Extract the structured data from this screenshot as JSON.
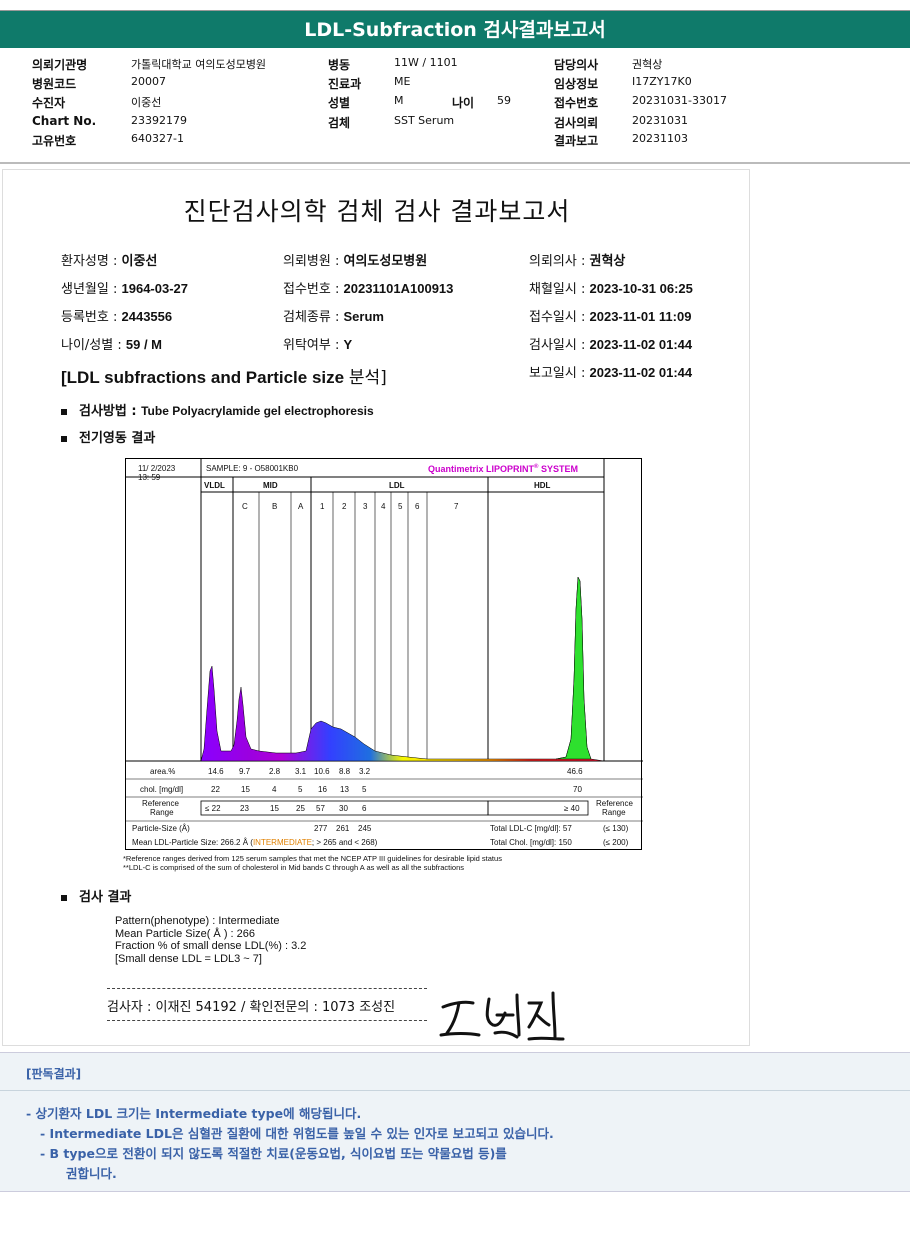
{
  "header": {
    "title": "LDL-Subfraction 검사결과보고서",
    "rows": [
      [
        {
          "l": "의뢰기관명",
          "v": "가톨릭대학교 여의도성모병원"
        },
        {
          "l": "병동",
          "v": "11W / 1101"
        },
        {
          "l": "담당의사",
          "v": "권혁상"
        }
      ],
      [
        {
          "l": "병원코드",
          "v": "20007"
        },
        {
          "l": "진료과",
          "v": "ME"
        },
        {
          "l": "임상정보",
          "v": "I17ZY17K0"
        }
      ],
      [
        {
          "l": "수진자",
          "v": "이중선"
        },
        {
          "l": "성별",
          "v": "M"
        },
        {
          "l": "접수번호",
          "v": "20231031-33017"
        }
      ],
      [
        {
          "l": "Chart No.",
          "v": "23392179"
        },
        {
          "l": "검체",
          "v": "SST Serum"
        },
        {
          "l": "검사의뢰",
          "v": "20231031"
        }
      ],
      [
        {
          "l": "고유번호",
          "v": "640327-1"
        },
        {
          "l": "",
          "v": ""
        },
        {
          "l": "결과보고",
          "v": "20231103"
        }
      ]
    ],
    "age_label": "나이",
    "age_value": "59"
  },
  "report": {
    "title": "진단검사의학 검체 검사 결과보고서",
    "info": [
      {
        "l": "환자성명 : ",
        "v": "이중선"
      },
      {
        "l": "의뢰병원 : ",
        "v": "여의도성모병원"
      },
      {
        "l": "의뢰의사 : ",
        "v": "권혁상"
      },
      {
        "l": "생년월일 : ",
        "v": "1964-03-27"
      },
      {
        "l": "접수번호 : ",
        "v": "20231101A100913"
      },
      {
        "l": "채혈일시 : ",
        "v": "2023-10-31 06:25"
      },
      {
        "l": "등록번호 : ",
        "v": "2443556"
      },
      {
        "l": "검체종류 : ",
        "v": "Serum"
      },
      {
        "l": "접수일시 : ",
        "v": "2023-11-01 11:09"
      },
      {
        "l": "나이/성별 : ",
        "v": "59 / M"
      },
      {
        "l": "위탁여부 : ",
        "v": "Y"
      },
      {
        "l": "검사일시 : ",
        "v": "2023-11-02 01:44"
      },
      {
        "l": "보고일시 : ",
        "v": "2023-11-02 01:44"
      }
    ],
    "section_title_en": "[LDL subfractions and Particle size ",
    "section_title_kr": "분석]",
    "method_label": "검사방법 : ",
    "method_value": "Tube Polyacrylamide gel electrophoresis",
    "electro_label": "전기영동 결과",
    "result_label": "검사 결과"
  },
  "chart": {
    "date": "11/  2/2023",
    "time": "13: 59",
    "sample": "SAMPLE:   9 - O58001KB0",
    "brand": "Quantimetrix LIPOPRINT",
    "brand_mark": "®",
    "brand_suffix": " SYSTEM",
    "zones": [
      "VLDL",
      "MID",
      "LDL",
      "HDL"
    ],
    "bands": [
      "C",
      "B",
      "A",
      "1",
      "2",
      "3",
      "4",
      "5",
      "6",
      "7"
    ],
    "area_label": "area.%",
    "area": [
      "14.6",
      "9.7",
      "2.8",
      "3.1",
      "10.6",
      "8.8",
      "3.2",
      "46.6"
    ],
    "chol_label": "chol. [mg/dl]",
    "chol": [
      "22",
      "15",
      "4",
      "5",
      "16",
      "13",
      "5",
      "70"
    ],
    "ref_label_1": "Reference",
    "ref_label_2": "Range",
    "ref_left": [
      "≤ 22",
      "23",
      "15",
      "25",
      "57",
      "30",
      "6"
    ],
    "ref_right": "≥ 40",
    "particle_label": "Particle-Size (Å)",
    "particle": [
      "277",
      "261",
      "245"
    ],
    "mean_label": "Mean LDL-Particle Size:   266.2 Å  (",
    "mean_type": "INTERMEDIATE",
    "mean_suffix": "; > 265 and < 268)",
    "total_ldl_label": "Total LDL-C [mg/dl]:  57",
    "total_ldl_ref": "(≤ 130)",
    "total_chol_label": "Total Chol. [mg/dl]:   150",
    "total_chol_ref": "(≤ 200)",
    "footnote1": "*Reference ranges derived from 125 serum samples that met the NCEP ATP III guidelines for desirable lipid status",
    "footnote2": "**LDL-C is comprised of the sum of cholesterol in Mid bands C through A as well as all the subfractions"
  },
  "result": {
    "lines": [
      "Pattern(phenotype) : Intermediate",
      "Mean Particle Size( Å ) : 266",
      "Fraction % of small dense LDL(%) : 3.2",
      "[Small dense LDL = LDL3 ~ 7]"
    ],
    "signature": "검사자 : 이재진  54192  /  확인전문의 : 1073  조성진"
  },
  "opinion": {
    "head": "[판독결과]",
    "l1": "-  상기환자 LDL 크기는 Intermediate type에 해당됩니다.",
    "l2": "-  Intermediate LDL은 심혈관 질환에 대한 위험도를 높일 수 있는 인자로 보고되고 있습니다.",
    "l3": "-  B type으로 전환이 되지 않도록 적절한 치료(운동요법, 식이요법 또는 약물요법 등)를",
    "l4": "권합니다."
  }
}
